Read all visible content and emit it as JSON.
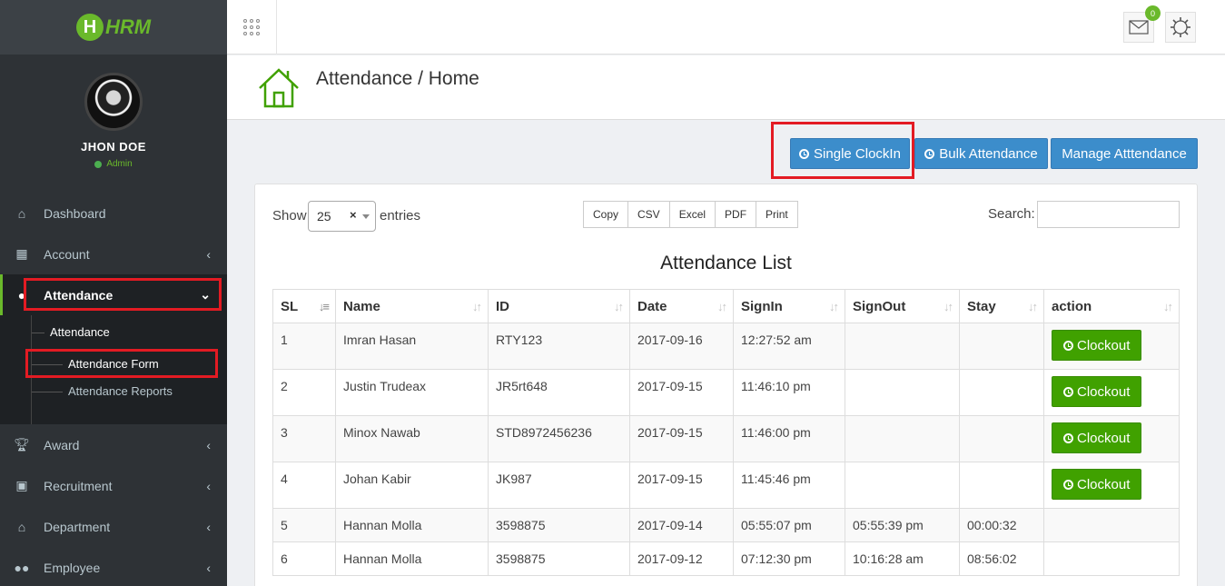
{
  "app": {
    "logo_letter": "H",
    "logo_text": "HRM"
  },
  "profile": {
    "name": "JHON DOE",
    "role": "Admin"
  },
  "menu": {
    "dashboard": "Dashboard",
    "account": "Account",
    "attendance": "Attendance",
    "attendance_sub": "Attendance",
    "attendance_form": "Attendance Form",
    "attendance_reports": "Attendance Reports",
    "award": "Award",
    "recruitment": "Recruitment",
    "department": "Department",
    "employee": "Employee"
  },
  "topbar": {
    "mail_count": "0"
  },
  "page": {
    "title": "Attendance / Home"
  },
  "actions": {
    "single_clockin": "Single ClockIn",
    "bulk_attendance": "Bulk Attendance",
    "manage_attendance": "Manage Atttendance"
  },
  "table_controls": {
    "show_label": "Show",
    "page_size": "25",
    "entries_label": "entries",
    "export": [
      "Copy",
      "CSV",
      "Excel",
      "PDF",
      "Print"
    ],
    "search_label": "Search:",
    "search_value": ""
  },
  "list_title": "Attendance List",
  "columns": [
    "SL",
    "Name",
    "ID",
    "Date",
    "SignIn",
    "SignOut",
    "Stay",
    "action"
  ],
  "clockout_label": "Clockout",
  "rows": [
    {
      "sl": "1",
      "name": "Imran Hasan",
      "id": "RTY123",
      "date": "2017-09-16",
      "signin": "12:27:52 am",
      "signout": "",
      "stay": ""
    },
    {
      "sl": "2",
      "name": "Justin Trudeax",
      "id": "JR5rt648",
      "date": "2017-09-15",
      "signin": "11:46:10 pm",
      "signout": "",
      "stay": ""
    },
    {
      "sl": "3",
      "name": "Minox Nawab",
      "id": "STD8972456236",
      "date": "2017-09-15",
      "signin": "11:46:00 pm",
      "signout": "",
      "stay": ""
    },
    {
      "sl": "4",
      "name": "Johan Kabir",
      "id": "JK987",
      "date": "2017-09-15",
      "signin": "11:45:46 pm",
      "signout": "",
      "stay": ""
    },
    {
      "sl": "5",
      "name": "Hannan Molla",
      "id": "3598875",
      "date": "2017-09-14",
      "signin": "05:55:07 pm",
      "signout": "05:55:39 pm",
      "stay": "00:00:32"
    },
    {
      "sl": "6",
      "name": "Hannan Molla",
      "id": "3598875",
      "date": "2017-09-12",
      "signin": "07:12:30 pm",
      "signout": "10:16:28 am",
      "stay": "08:56:02"
    }
  ]
}
